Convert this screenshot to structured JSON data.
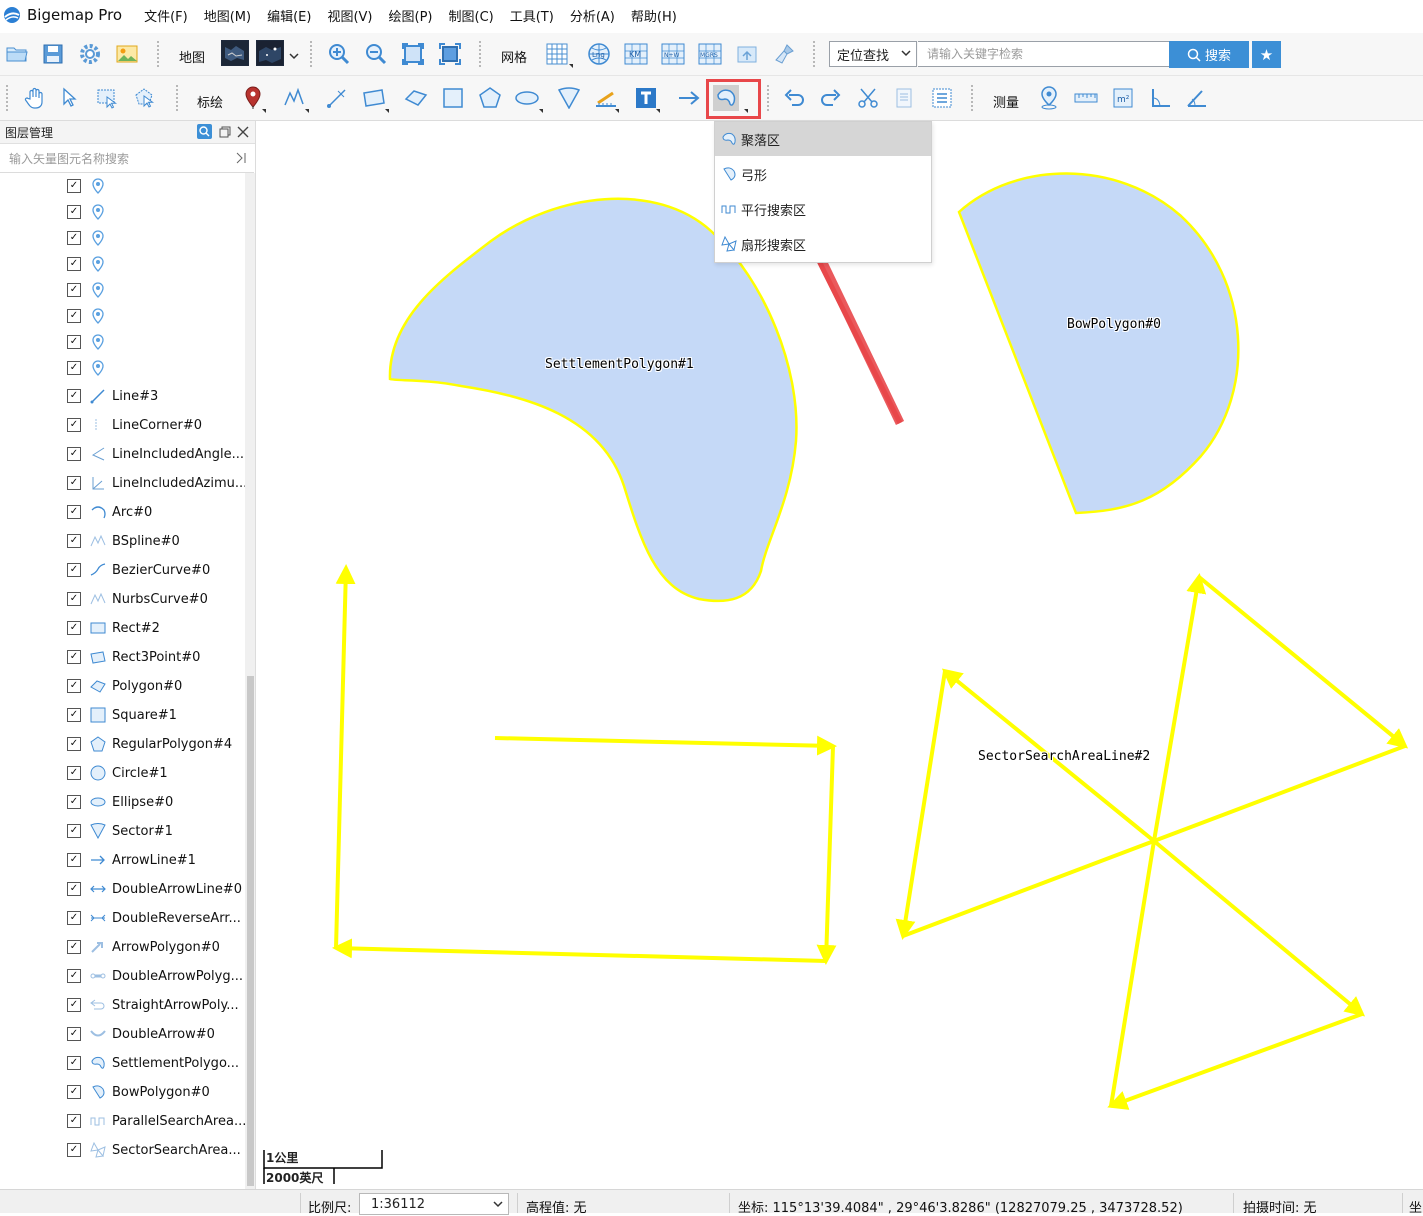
{
  "app": {
    "title": "Bigemap Pro"
  },
  "menu": [
    "文件(F)",
    "地图(M)",
    "编辑(E)",
    "视图(V)",
    "绘图(P)",
    "制图(C)",
    "工具(T)",
    "分析(A)",
    "帮助(H)"
  ],
  "toolbar1": {
    "map_label": "网格",
    "map_section_label": "地图",
    "locate_label": "定位查找",
    "search_placeholder": "请输入关键字检索",
    "search_button": "搜索"
  },
  "toolbar2": {
    "draw_label": "标绘",
    "measure_label": "测量"
  },
  "panel": {
    "title": "图层管理",
    "search_placeholder": "输入矢量图元名称搜索",
    "items": [
      {
        "name": "",
        "icon": "marker-icon"
      },
      {
        "name": "",
        "icon": "marker-icon"
      },
      {
        "name": "",
        "icon": "marker-icon"
      },
      {
        "name": "",
        "icon": "marker-icon"
      },
      {
        "name": "",
        "icon": "marker-icon"
      },
      {
        "name": "",
        "icon": "marker-icon"
      },
      {
        "name": "",
        "icon": "marker-icon"
      },
      {
        "name": "",
        "icon": "marker-icon"
      },
      {
        "name": "Line#3",
        "icon": "line-icon"
      },
      {
        "name": "LineCorner#0",
        "icon": "line-corner-icon"
      },
      {
        "name": "LineIncludedAngle...",
        "icon": "angle-icon"
      },
      {
        "name": "LineIncludedAzimu...",
        "icon": "azimuth-icon"
      },
      {
        "name": "Arc#0",
        "icon": "arc-icon"
      },
      {
        "name": "BSpline#0",
        "icon": "bspline-icon"
      },
      {
        "name": "BezierCurve#0",
        "icon": "bezier-icon"
      },
      {
        "name": "NurbsCurve#0",
        "icon": "nurbs-icon"
      },
      {
        "name": "Rect#2",
        "icon": "rect-icon"
      },
      {
        "name": "Rect3Point#0",
        "icon": "rect3point-icon"
      },
      {
        "name": "Polygon#0",
        "icon": "polygon-icon"
      },
      {
        "name": "Square#1",
        "icon": "square-icon"
      },
      {
        "name": "RegularPolygon#4",
        "icon": "pentagon-icon"
      },
      {
        "name": "Circle#1",
        "icon": "circle-icon"
      },
      {
        "name": "Ellipse#0",
        "icon": "ellipse-icon"
      },
      {
        "name": "Sector#1",
        "icon": "sector-icon"
      },
      {
        "name": "ArrowLine#1",
        "icon": "arrow-line-icon"
      },
      {
        "name": "DoubleArrowLine#0",
        "icon": "double-arrow-line-icon"
      },
      {
        "name": "DoubleReverseArr...",
        "icon": "double-reverse-arrow-icon"
      },
      {
        "name": "ArrowPolygon#0",
        "icon": "arrow-polygon-icon"
      },
      {
        "name": "DoubleArrowPolyg...",
        "icon": "double-arrow-polygon-icon"
      },
      {
        "name": "StraightArrowPoly...",
        "icon": "straight-arrow-polygon-icon"
      },
      {
        "name": "DoubleArrow#0",
        "icon": "double-arrow-icon"
      },
      {
        "name": "SettlementPolygo...",
        "icon": "settlement-icon"
      },
      {
        "name": "BowPolygon#0",
        "icon": "bow-icon"
      },
      {
        "name": "ParallelSearchArea...",
        "icon": "parallel-search-icon"
      },
      {
        "name": "SectorSearchArea...",
        "icon": "sector-search-icon"
      }
    ]
  },
  "dropdown": {
    "items": [
      "聚落区",
      "弓形",
      "平行搜索区",
      "扇形搜索区"
    ]
  },
  "map": {
    "labels": {
      "settlement": "SettlementPolygon#1",
      "bow": "BowPolygon#0",
      "sector_search": "SectorSearchAreaLine#2"
    },
    "fill_color": "#c5d9f7",
    "stroke_color": "#ffff00",
    "highlight_color": "#e8474a"
  },
  "scale": {
    "km": "1公里",
    "ft": "2000英尺"
  },
  "status": {
    "scale_label": "比例尺:",
    "scale_value": "1:36112",
    "elevation": "高程值: 无",
    "coords": "坐标: 115°13'39.4084\" , 29°46'3.8286\"  (12827079.25 , 3473728.52)",
    "capture_time": "拍摄时间: 无",
    "tail": "坐"
  }
}
